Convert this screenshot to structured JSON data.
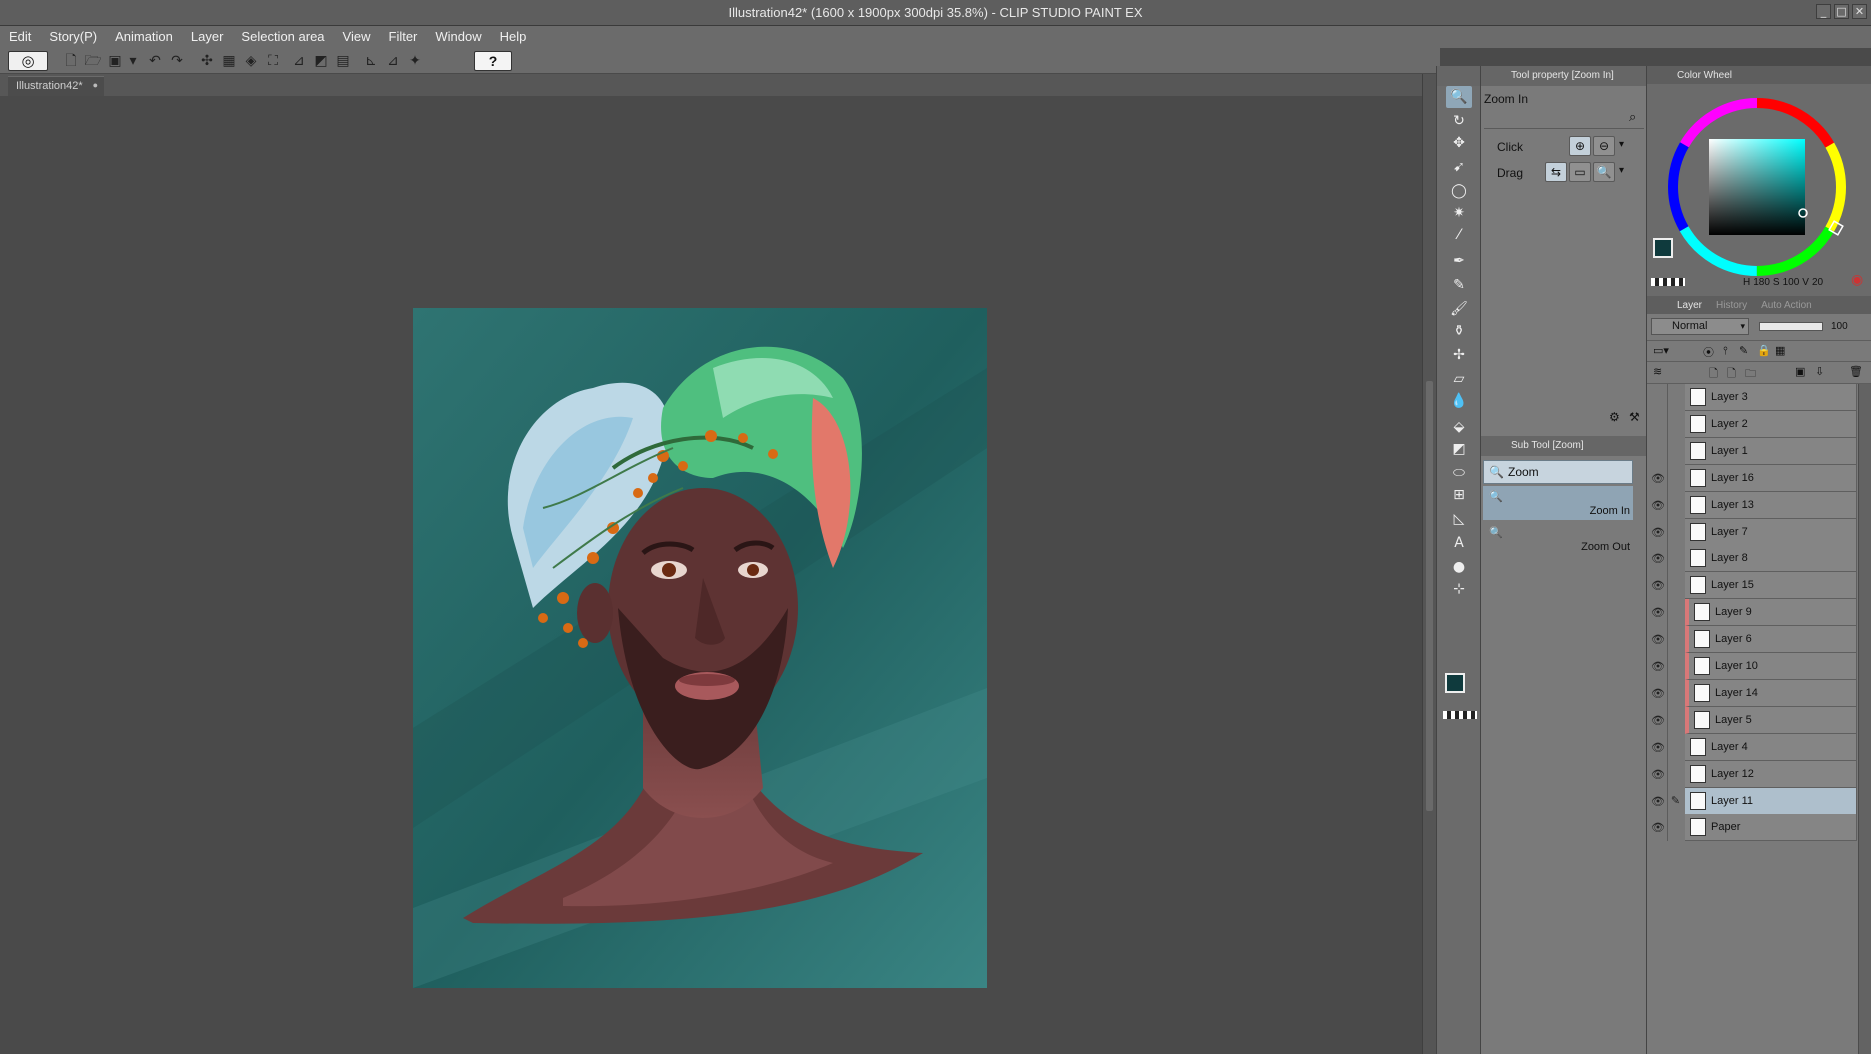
{
  "window": {
    "title": "Illustration42* (1600 x 1900px 300dpi 35.8%)  - CLIP STUDIO PAINT EX",
    "controls": [
      "_",
      "□",
      "✕"
    ]
  },
  "menu": [
    "Edit",
    "Story(P)",
    "Animation",
    "Layer",
    "Selection area",
    "View",
    "Filter",
    "Window",
    "Help"
  ],
  "document_tab": {
    "label": "Illustration42*",
    "close": "●"
  },
  "command_bar": {
    "logo": "◎",
    "help": "?",
    "buttons": [
      {
        "name": "new-icon",
        "glyph": "🗋"
      },
      {
        "name": "open-icon",
        "glyph": "🗁"
      },
      {
        "name": "save-icon",
        "glyph": "▣"
      },
      {
        "name": "save-menu-icon",
        "glyph": "▾"
      },
      {
        "name": "undo-icon",
        "glyph": "↶"
      },
      {
        "name": "redo-icon",
        "glyph": "↷"
      },
      {
        "name": "transform-icon",
        "glyph": "✣"
      },
      {
        "name": "clear-icon",
        "glyph": "▦"
      },
      {
        "name": "fill-icon",
        "glyph": "◈"
      },
      {
        "name": "scale-icon",
        "glyph": "⛶"
      },
      {
        "name": "crop-icon",
        "glyph": "⊿"
      },
      {
        "name": "invert-icon",
        "glyph": "◩"
      },
      {
        "name": "select-icon",
        "glyph": "▤"
      },
      {
        "name": "snap-ruler-icon",
        "glyph": "⊾"
      },
      {
        "name": "snap-special-icon",
        "glyph": "⊿"
      },
      {
        "name": "snap-grid-icon",
        "glyph": "✦"
      }
    ]
  },
  "tools": [
    {
      "name": "zoom-tool-icon",
      "glyph": "🔍",
      "active": true
    },
    {
      "name": "rotate-tool-icon",
      "glyph": "↻"
    },
    {
      "name": "move-tool-icon",
      "glyph": "✥"
    },
    {
      "name": "operation-tool-icon",
      "glyph": "➹"
    },
    {
      "name": "lasso-tool-icon",
      "glyph": "◯"
    },
    {
      "name": "magic-wand-tool-icon",
      "glyph": "✷"
    },
    {
      "name": "eyedropper-tool-icon",
      "glyph": "⁄"
    },
    {
      "name": "pen-tool-icon",
      "glyph": "✒"
    },
    {
      "name": "pencil-tool-icon",
      "glyph": "✎"
    },
    {
      "name": "brush-tool-icon",
      "glyph": "🖌"
    },
    {
      "name": "airbrush-tool-icon",
      "glyph": "⚱"
    },
    {
      "name": "decoration-tool-icon",
      "glyph": "✢"
    },
    {
      "name": "eraser-tool-icon",
      "glyph": "▱"
    },
    {
      "name": "blend-tool-icon",
      "glyph": "💧"
    },
    {
      "name": "fill-tool-icon",
      "glyph": "⬙"
    },
    {
      "name": "gradient-tool-icon",
      "glyph": "◩"
    },
    {
      "name": "figure-tool-icon",
      "glyph": "⬭"
    },
    {
      "name": "frame-tool-icon",
      "glyph": "⊞"
    },
    {
      "name": "ruler-tool-icon",
      "glyph": "◺"
    },
    {
      "name": "text-tool-icon",
      "glyph": "A"
    },
    {
      "name": "balloon-tool-icon",
      "glyph": "●"
    },
    {
      "name": "correct-line-tool-icon",
      "glyph": "⊹"
    }
  ],
  "tool_property": {
    "title": "Tool property [Zoom In]",
    "tool_name": "Zoom In",
    "click_label": "Click",
    "drag_label": "Drag"
  },
  "sub_tool": {
    "title": "Sub Tool [Zoom]",
    "group": "Zoom",
    "items": [
      {
        "label": "Zoom In",
        "selected": true
      },
      {
        "label": "Zoom Out",
        "selected": false
      }
    ]
  },
  "color_panel": {
    "tabs": [
      "Color Wheel"
    ],
    "h_label": "H",
    "h_value": "180",
    "s_label": "S",
    "s_value": "100",
    "v_label": "V",
    "v_value": "20",
    "main_color": "#0f3a3d",
    "sub_color": "#ffffff"
  },
  "layer_panel": {
    "tabs": [
      "Layer",
      "History",
      "Auto Action"
    ],
    "blend_mode": "Normal",
    "opacity": "100",
    "layers": [
      {
        "name": "Layer 3",
        "visible": false,
        "clip": false,
        "selected": false
      },
      {
        "name": "Layer 2",
        "visible": false,
        "clip": false,
        "selected": false
      },
      {
        "name": "Layer 1",
        "visible": false,
        "clip": false,
        "selected": false
      },
      {
        "name": "Layer 16",
        "visible": true,
        "clip": false,
        "selected": false
      },
      {
        "name": "Layer 13",
        "visible": true,
        "clip": false,
        "selected": false
      },
      {
        "name": "Layer 7",
        "visible": true,
        "clip": false,
        "selected": false
      },
      {
        "name": "Layer 8",
        "visible": true,
        "clip": false,
        "selected": false
      },
      {
        "name": "Layer 15",
        "visible": true,
        "clip": false,
        "selected": false
      },
      {
        "name": "Layer 9",
        "visible": true,
        "clip": true,
        "selected": false
      },
      {
        "name": "Layer 6",
        "visible": true,
        "clip": true,
        "selected": false
      },
      {
        "name": "Layer 10",
        "visible": true,
        "clip": true,
        "selected": false
      },
      {
        "name": "Layer 14",
        "visible": true,
        "clip": true,
        "selected": false
      },
      {
        "name": "Layer 5",
        "visible": true,
        "clip": true,
        "selected": false
      },
      {
        "name": "Layer 4",
        "visible": true,
        "clip": false,
        "selected": false
      },
      {
        "name": "Layer 12",
        "visible": true,
        "clip": false,
        "selected": false
      },
      {
        "name": "Layer 11",
        "visible": true,
        "clip": false,
        "selected": true
      },
      {
        "name": "Paper",
        "visible": true,
        "clip": false,
        "selected": false
      }
    ]
  }
}
